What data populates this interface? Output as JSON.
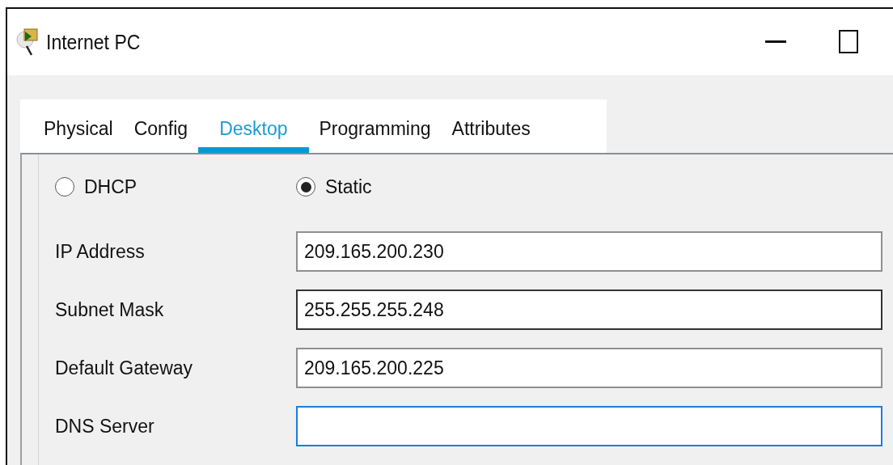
{
  "window": {
    "title": "Internet PC"
  },
  "tabs": [
    {
      "label": "Physical",
      "selected": false
    },
    {
      "label": "Config",
      "selected": false
    },
    {
      "label": "Desktop",
      "selected": true
    },
    {
      "label": "Programming",
      "selected": false
    },
    {
      "label": "Attributes",
      "selected": false
    }
  ],
  "ip_mode": [
    {
      "label": "DHCP",
      "selected": false
    },
    {
      "label": "Static",
      "selected": true
    }
  ],
  "fields": [
    {
      "label": "IP Address",
      "value": "209.165.200.230",
      "focused": false,
      "hovered": false
    },
    {
      "label": "Subnet Mask",
      "value": "255.255.255.248",
      "focused": false,
      "hovered": true
    },
    {
      "label": "Default Gateway",
      "value": "209.165.200.225",
      "focused": false,
      "hovered": false
    },
    {
      "label": "DNS Server",
      "focused": true,
      "hovered": false
    }
  ]
}
